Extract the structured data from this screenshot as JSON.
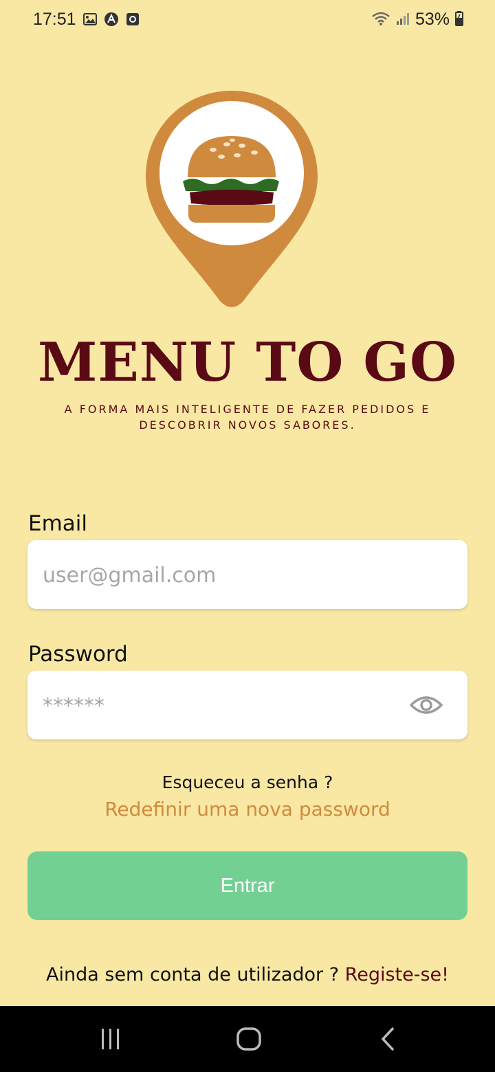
{
  "status_bar": {
    "time": "17:51",
    "icons": [
      "image-icon",
      "app-a-icon",
      "square-app-icon"
    ],
    "battery_percent": "53%",
    "right_icons": [
      "wifi-icon",
      "signal-icon",
      "battery-icon"
    ]
  },
  "brand": {
    "title": "MENU TO GO",
    "tagline_line1": "A FORMA MAIS INTELIGENTE DE FAZER PEDIDOS E",
    "tagline_line2": "DESCOBRIR NOVOS SABORES.",
    "logo_icon": "burger-pin-icon",
    "colors": {
      "pin": "#d08a3e",
      "title": "#5a0a15"
    }
  },
  "form": {
    "email_label": "Email",
    "email_placeholder": "user@gmail.com",
    "email_value": "",
    "password_label": "Password",
    "password_placeholder": "******",
    "password_value": "",
    "show_password_icon": "eye-icon"
  },
  "forgot": {
    "question": "Esqueceu a senha ?",
    "reset_link": "Redefinir uma nova password"
  },
  "submit": {
    "label": "Entrar",
    "color": "#73d093"
  },
  "signup": {
    "prompt": "Ainda sem conta de utilizador ? ",
    "link": "Registe-se!"
  },
  "nav_bar": {
    "buttons": [
      "recent-apps-icon",
      "home-icon",
      "back-icon"
    ]
  },
  "theme": {
    "background": "#f9e8a4",
    "link_color": "#d08a3e"
  }
}
